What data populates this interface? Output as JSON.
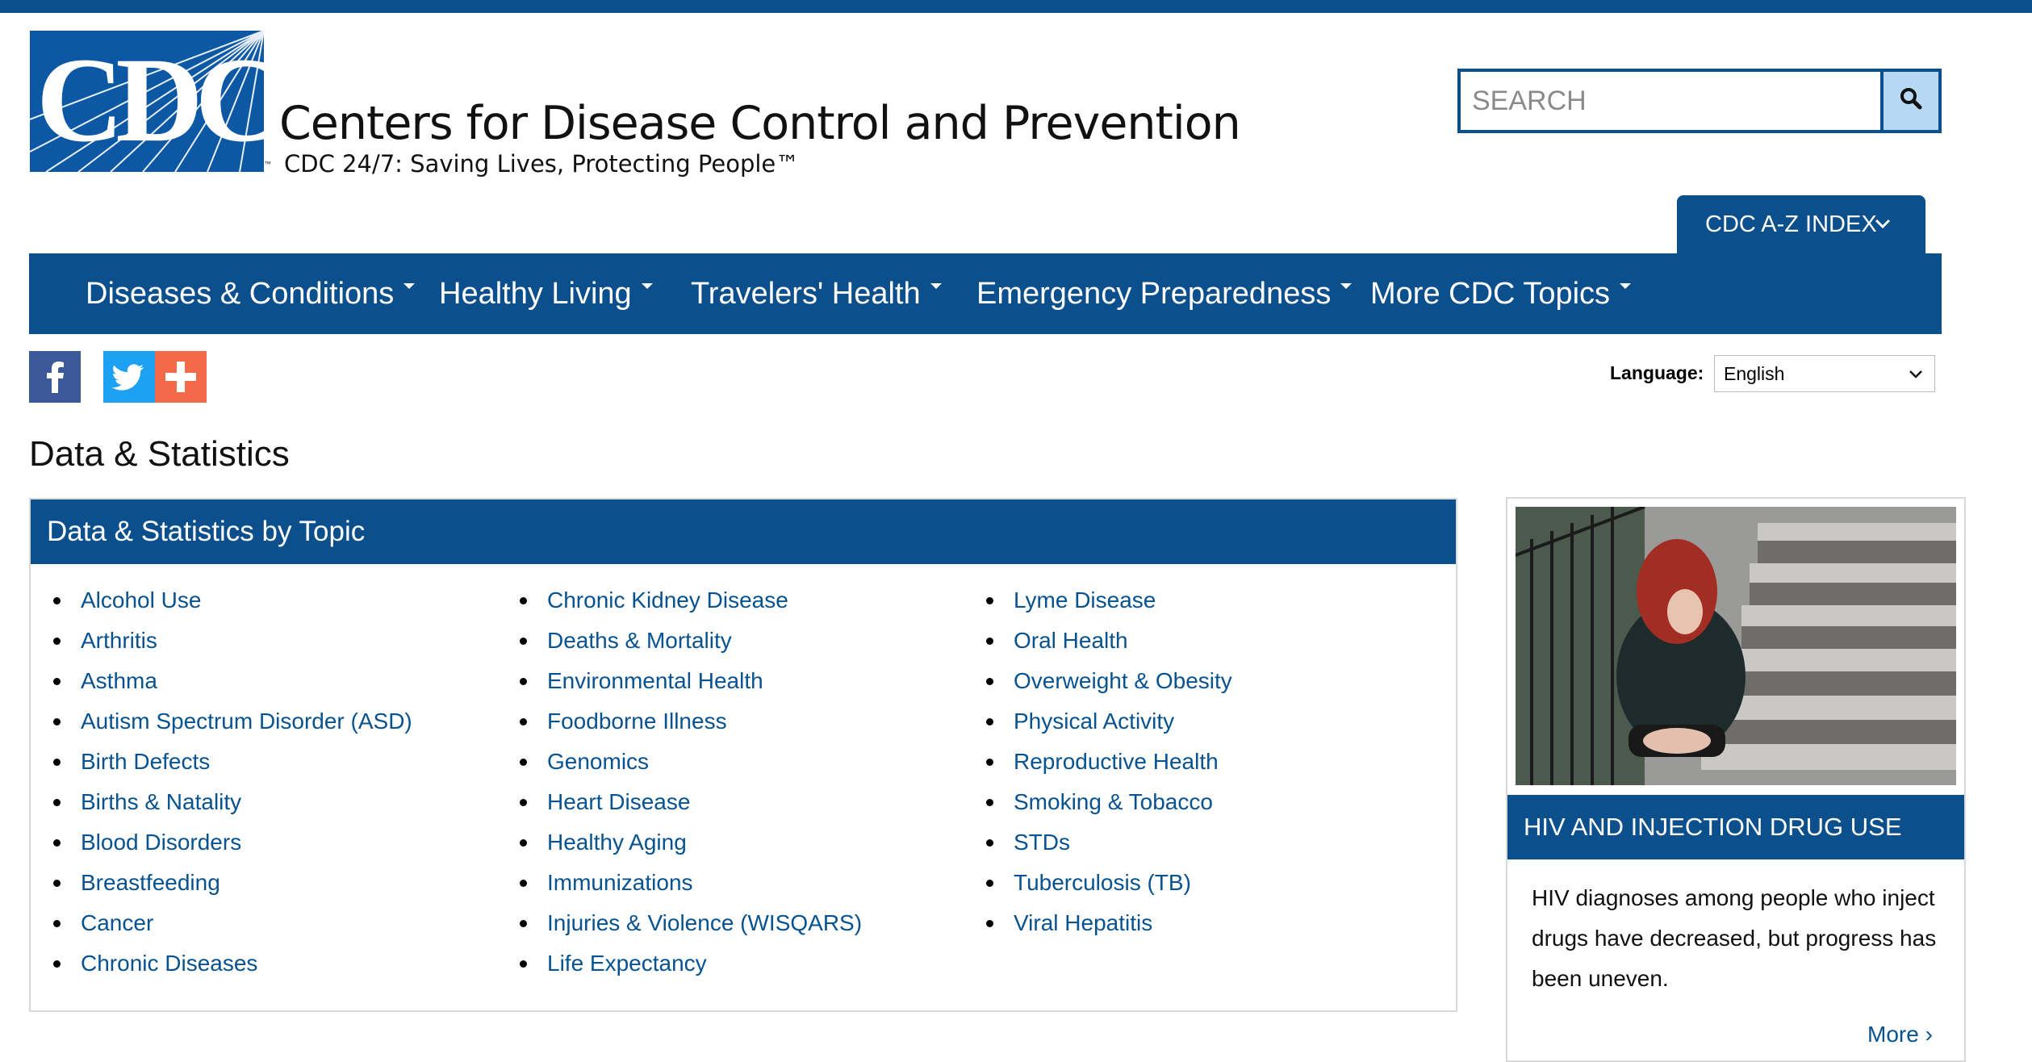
{
  "header": {
    "logo_text": "CDC",
    "org_name": "Centers for Disease Control and Prevention",
    "tagline": "CDC 24/7: Saving Lives, Protecting People™",
    "search_placeholder": "SEARCH",
    "az_index_label": "CDC A-Z INDEX"
  },
  "nav": {
    "items": [
      {
        "label": "Diseases & Conditions"
      },
      {
        "label": "Healthy Living"
      },
      {
        "label": "Travelers' Health"
      },
      {
        "label": "Emergency Preparedness"
      },
      {
        "label": "More CDC Topics"
      }
    ]
  },
  "language": {
    "label": "Language:",
    "selected": "English"
  },
  "page": {
    "title": "Data & Statistics"
  },
  "topics": {
    "heading": "Data & Statistics by Topic",
    "col1": [
      "Alcohol Use",
      "Arthritis",
      "Asthma",
      "Autism Spectrum Disorder (ASD)",
      "Birth Defects",
      "Births & Natality",
      "Blood Disorders",
      "Breastfeeding",
      "Cancer",
      "Chronic Diseases"
    ],
    "col2": [
      "Chronic Kidney Disease",
      "Deaths & Mortality",
      "Environmental Health",
      "Foodborne Illness",
      "Genomics",
      "Heart Disease",
      "Healthy Aging",
      "Immunizations",
      "Injuries & Violence (WISQARS)",
      "Life Expectancy"
    ],
    "col3": [
      "Lyme Disease",
      "Oral Health",
      "Overweight & Obesity",
      "Physical Activity",
      "Reproductive Health",
      "Smoking & Tobacco",
      "STDs",
      "Tuberculosis (TB)",
      "Viral Hepatitis"
    ]
  },
  "feature": {
    "heading": "HIV AND INJECTION DRUG USE",
    "body": "HIV diagnoses among people who inject drugs have decreased, but progress has been uneven.",
    "more": "More ›"
  },
  "colors": {
    "brand_blue": "#0b4f8d",
    "link_blue": "#075290",
    "search_button_bg": "#b7d8f5"
  }
}
